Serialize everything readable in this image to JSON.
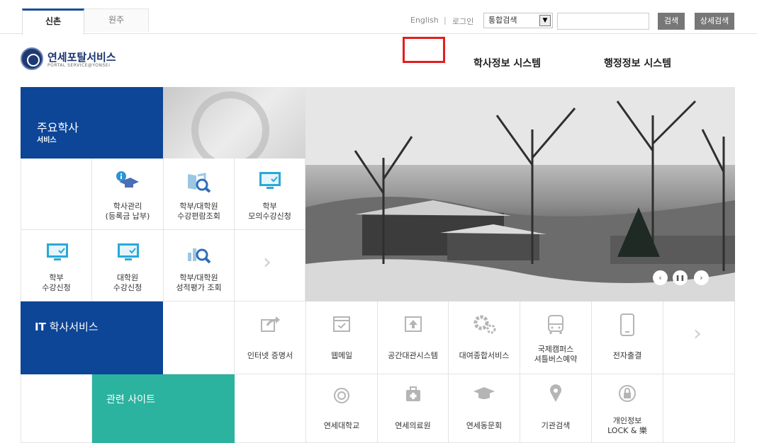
{
  "top": {
    "campus_tabs": [
      "신촌",
      "원주"
    ],
    "english": "English",
    "separator": "|",
    "login": "로그인",
    "search_scope": "통합검색",
    "search_button": "검색",
    "detail_search_button": "상세검색"
  },
  "header": {
    "logo_title": "연세포탈서비스",
    "logo_sub": "PORTAL SERVICE@YONSEI",
    "academic_system": "학사정보 시스템",
    "admin_system": "행정정보 시스템"
  },
  "academic": {
    "title": "주요학사",
    "subtitle": "서비스",
    "items": [
      [
        "학사관리",
        "(등록금 납부)"
      ],
      [
        "학부/대학원",
        "수강편람조회"
      ],
      [
        "학부",
        "모의수강신청"
      ],
      [
        "학부",
        "수강신청"
      ],
      [
        "대학원",
        "수강신청"
      ],
      [
        "학부/대학원",
        "성적평가 조회"
      ]
    ]
  },
  "it": {
    "title_bold": "IT",
    "title_rest": "학사서비스",
    "items": [
      "인터넷 증명서",
      "웹메일",
      "공간대관시스템",
      "대여종합서비스",
      "국제캠퍼스",
      "셔틀버스예약",
      "전자출결"
    ]
  },
  "related": {
    "title": "관련 사이트",
    "items": [
      "연세대학교",
      "연세의료원",
      "연세동문회",
      "기관검색",
      "개인정보",
      "LOCK & 樂"
    ]
  },
  "icons": {
    "next": "›",
    "prev": "‹",
    "pause": "❚❚",
    "dropdown": "▼"
  },
  "colors": {
    "brand_blue": "#0d4597",
    "teal": "#2bb3a0",
    "highlight": "#e41d1d"
  }
}
